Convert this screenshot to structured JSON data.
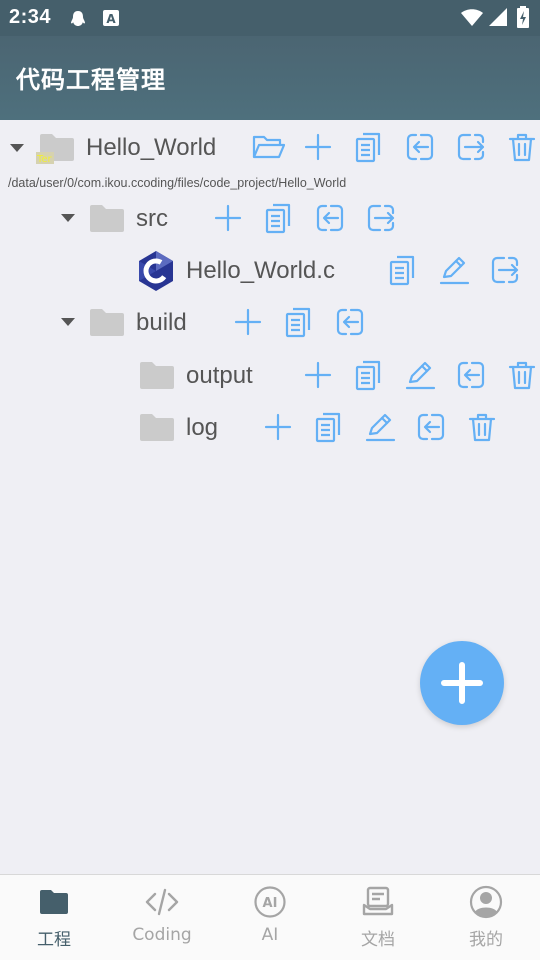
{
  "status_bar": {
    "time": "2:34"
  },
  "app_bar": {
    "title": "代码工程管理"
  },
  "project": {
    "name": "Hello_World",
    "path": "/data/user/0/com.ikou.ccoding/files/code_project/Hello_World",
    "children": {
      "src": {
        "name": "src",
        "file": {
          "name": "Hello_World.c"
        }
      },
      "build": {
        "name": "build",
        "output": {
          "name": "output"
        },
        "log": {
          "name": "log"
        }
      }
    }
  },
  "colors": {
    "accent": "#64b0f5",
    "appbar": "#4b6572",
    "folder": "#cbcbcb",
    "text": "#555555"
  },
  "bottom_nav": {
    "items": [
      {
        "label": "工程",
        "icon": "folder-icon",
        "active": true
      },
      {
        "label": "Coding",
        "icon": "code-icon",
        "active": false
      },
      {
        "label": "AI",
        "icon": "ai-icon",
        "active": false
      },
      {
        "label": "文档",
        "icon": "document-icon",
        "active": false
      },
      {
        "label": "我的",
        "icon": "profile-icon",
        "active": false
      }
    ]
  }
}
